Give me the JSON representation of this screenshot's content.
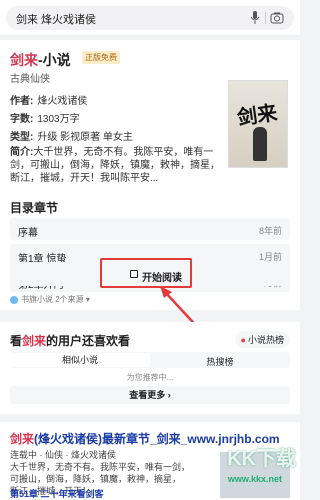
{
  "search": {
    "query": "剑来 烽火戏诸侯"
  },
  "book": {
    "title_red": "剑来",
    "title_rest": "-小说",
    "badge": "正版免费",
    "genre": "古典仙侠",
    "author_label": "作者:",
    "author": "烽火戏诸侯",
    "words_label": "字数:",
    "words": "1303万字",
    "type_label": "类型:",
    "type": "升级 影视原著 单女主",
    "intro_label": "简介:",
    "intro": "大千世界，无奇不有。我陈平安，唯有一剑，可搬山，倒海，降妖，镇魔，敕神，摘星，断江，摧城，开天！我叫陈平安...",
    "cover_text": "剑来"
  },
  "chapters": {
    "heading": "目录章节",
    "items": [
      {
        "name": "序幕",
        "time": "8年前"
      },
      {
        "name": "第1章 惊蛰",
        "time": "1月前"
      },
      {
        "name": "第2章开门",
        "time": "4月前"
      }
    ],
    "start_label": "开始阅读"
  },
  "source": {
    "text": "书旗小说 2个来源"
  },
  "recommend": {
    "title_pre": "看",
    "title_red": "剑来",
    "title_post": "的用户还喜欢看",
    "hot_label": "小说热榜",
    "tabs": [
      "相似小说",
      "热搜榜"
    ],
    "hint": "为您推荐中...",
    "more_label": "查看更多"
  },
  "result": {
    "title_red": "剑来",
    "title_rest": "(烽火戏诸侯)最新章节_剑来_www.jnrjhb.com",
    "line1": "连载中 · 仙侠 · 烽火戏诸侯",
    "line2": "大千世界，无奇不有。我陈平安，唯有一剑，",
    "line3": "可搬山，倒海，降妖，镇魔，敕神，摘星，",
    "line4": "断江，摧城，开天！",
    "footer": "第51章 二十年来看剑客"
  },
  "watermark": {
    "text": "KK下载",
    "url": "www.kkx.net"
  },
  "colors": {
    "accent_red": "#d9344c",
    "link_blue": "#1b3ca8",
    "highlight_red": "#e53a3a"
  }
}
